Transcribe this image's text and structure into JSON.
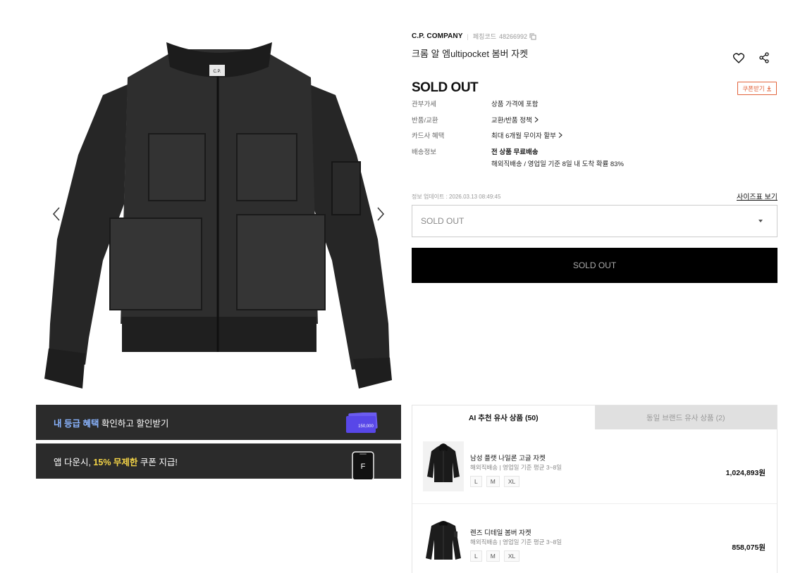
{
  "gallery": {
    "thumb_label": "C.P.",
    "prev_icon": "chevron-left-icon",
    "next_icon": "chevron-right-icon"
  },
  "banners": {
    "grade": {
      "hl": "내 등급 혜택",
      "rest": " 확인하고 할인받기",
      "card_amount": "150,000"
    },
    "app": {
      "pre": "앱 다운시, ",
      "hl": "15% 무제한",
      "post": " 쿠폰 지급!",
      "logo": "F"
    }
  },
  "product": {
    "brand": "C.P. COMPANY",
    "code_label": "페칭코드",
    "code": "48266992",
    "title": "크롬 알 엠ultipocket 봄버 자켓",
    "status": "SOLD OUT",
    "coupon_label": "쿠폰받기"
  },
  "info": [
    {
      "label": "관부가세",
      "value": "상품 가격에 포함",
      "link": false,
      "bold": false
    },
    {
      "label": "반품/교환",
      "value": "교환/반품 정책",
      "link": true,
      "bold": false
    },
    {
      "label": "카드사 혜택",
      "value": "최대 6개월 무이자 할부",
      "link": true,
      "bold": false
    },
    {
      "label": "배송정보",
      "value": "전 상품 무료배송",
      "link": false,
      "bold": true
    }
  ],
  "shipping_detail": "해외직배송 / 영업일 기준 8일 내 도착 확률 83%",
  "updated": "정보 업데이트 : 2026.03.13 08:49:45",
  "size_chart": "사이즈표 보기",
  "option_select": {
    "value": "SOLD OUT"
  },
  "buy_button": "SOLD OUT",
  "similar": {
    "tabs": [
      "AI 추천 유사 상품 (50)",
      "동일 브랜드 유사 상품 (2)"
    ],
    "items": [
      {
        "name": "남성 플랫 나일론 고글 자켓",
        "meta": "해외직배송 | 영업일 기준 평균 3~8일",
        "sizes": [
          "L",
          "M",
          "XL"
        ],
        "price": "1,024,893원"
      },
      {
        "name": "렌즈 디테일 봄버 자켓",
        "meta": "해외직배송 | 영업일 기준 평균 3~8일",
        "sizes": [
          "L",
          "M",
          "XL"
        ],
        "price": "858,075원"
      }
    ]
  },
  "colors": {
    "accent": "#e2623a",
    "dark_banner": "#2b2b2b",
    "blue_hl": "#8ab4ff",
    "yellow_hl": "#f5d547"
  }
}
